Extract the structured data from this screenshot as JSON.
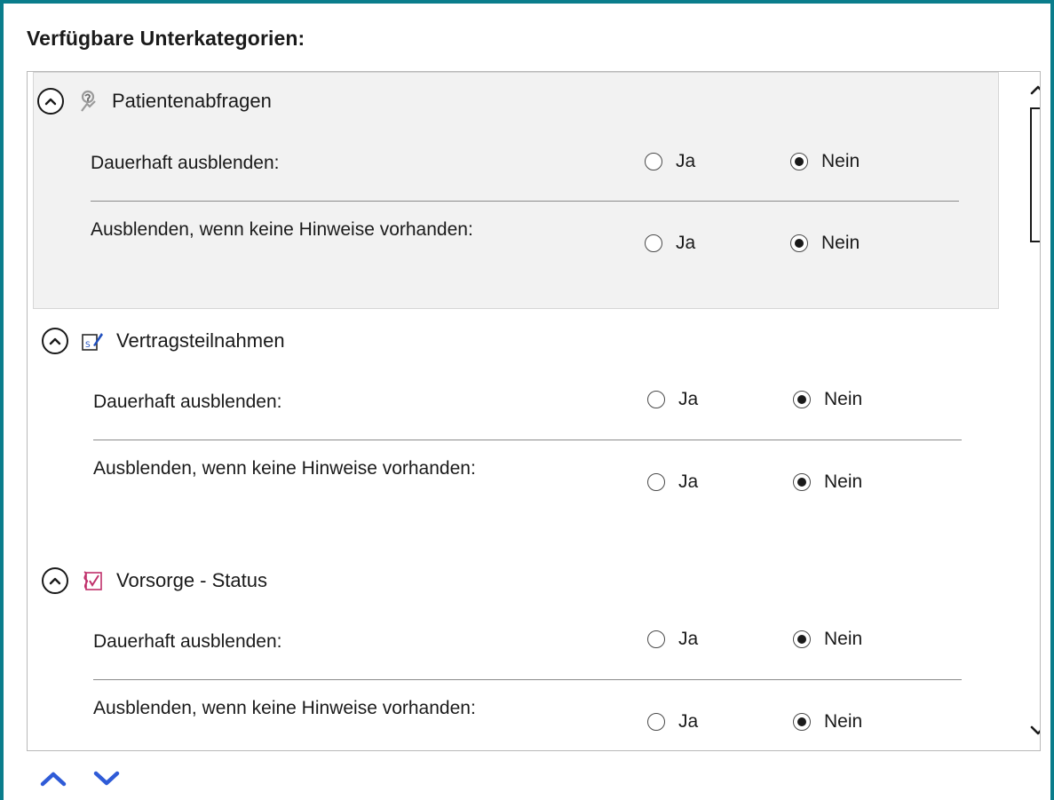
{
  "heading": "Verfügbare Unterkategorien:",
  "colors": {
    "frame": "#0a7d8c",
    "arrow_buttons": "#2f5bd7"
  },
  "yes_label": "Ja",
  "no_label": "Nein",
  "categories": [
    {
      "title": "Patientenabfragen",
      "icon": "patient-query-icon",
      "expanded": true,
      "selected": true,
      "hide_permanently": {
        "label": "Dauerhaft ausblenden:",
        "value": "Nein"
      },
      "hide_if_empty": {
        "label": "Ausblenden, wenn keine Hinweise vorhanden:",
        "value": "Nein"
      }
    },
    {
      "title": "Vertragsteilnahmen",
      "icon": "contract-participation-icon",
      "expanded": true,
      "selected": false,
      "hide_permanently": {
        "label": "Dauerhaft ausblenden:",
        "value": "Nein"
      },
      "hide_if_empty": {
        "label": "Ausblenden, wenn keine Hinweise vorhanden:",
        "value": "Nein"
      }
    },
    {
      "title": "Vorsorge - Status",
      "icon": "prevention-status-icon",
      "expanded": true,
      "selected": false,
      "hide_permanently": {
        "label": "Dauerhaft ausblenden:",
        "value": "Nein"
      },
      "hide_if_empty": {
        "label": "Ausblenden, wenn keine Hinweise vorhanden:",
        "value": "Nein"
      }
    }
  ],
  "icons": {
    "scroll_up": "chevron-up-icon",
    "scroll_down": "chevron-down-icon",
    "move_up": "move-up-icon",
    "move_down": "move-down-icon"
  }
}
